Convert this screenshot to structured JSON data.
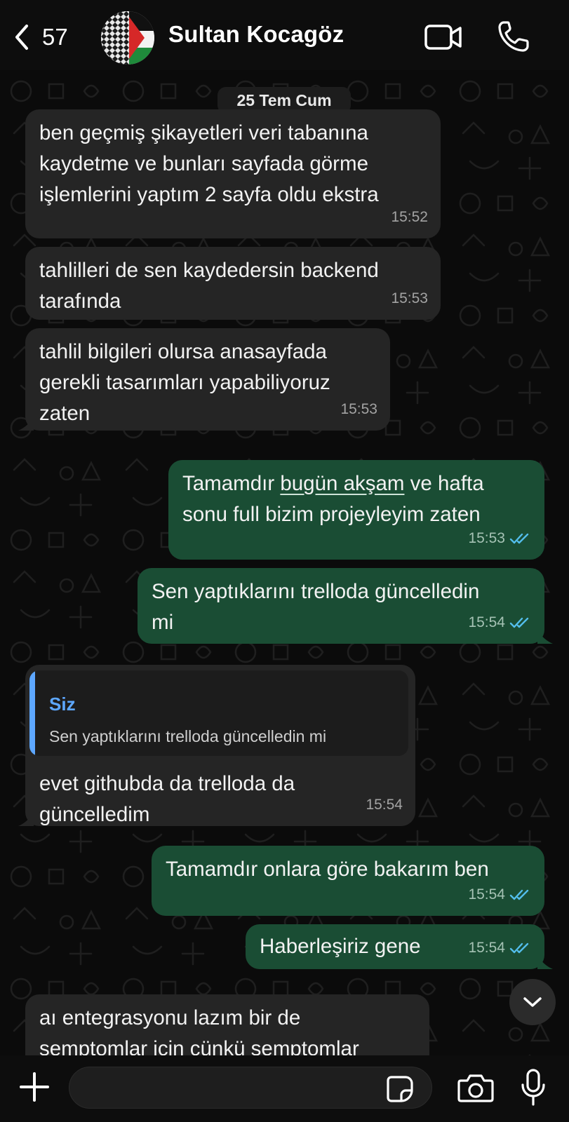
{
  "header": {
    "back_count": "57",
    "contact_name": "Sultan Kocagöz"
  },
  "date_chip": "25 Tem Cum",
  "messages": [
    {
      "direction": "in",
      "text": "ben geçmiş şikayetleri veri tabanına\nkaydetme ve bunları sayfada görme\nişlemlerini yaptım 2 sayfa oldu ekstra",
      "time": "15:52"
    },
    {
      "direction": "in",
      "text": "tahlilleri de sen kaydedersin backend\ntarafında",
      "time": "15:53"
    },
    {
      "direction": "in",
      "text": "tahlil bilgileri olursa anasayfada\ngerekli tasarımları yapabiliyoruz\nzaten",
      "time": "15:53"
    },
    {
      "direction": "out",
      "text_before": "Tamamdır ",
      "text_link": "bugün akşam",
      "text_after": " ve hafta\nsonu full bizim projeyleyim zaten",
      "time": "15:53",
      "status": "read"
    },
    {
      "direction": "out",
      "text": "Sen yaptıklarını trelloda güncelledin\nmi",
      "time": "15:54",
      "status": "read"
    },
    {
      "direction": "in",
      "quote_author": "Siz",
      "quote_text": "Sen yaptıklarını trelloda güncelledin mi",
      "text": "evet githubda da trelloda da\ngüncelledim",
      "time": "15:54"
    },
    {
      "direction": "out",
      "text": "Tamamdır onlara göre bakarım ben",
      "time": "15:54",
      "status": "read"
    },
    {
      "direction": "out",
      "text": "Haberleşiriz gene",
      "time": "15:54",
      "status": "read"
    },
    {
      "direction": "in",
      "text": "aı entegrasyonu lazım bir de\nsemptomlar için çünkü semptomlar",
      "time": ""
    }
  ],
  "composer": {
    "value": "",
    "placeholder": ""
  },
  "icons": [
    "back-chevron-icon",
    "video-call-icon",
    "phone-icon",
    "chevron-down-icon",
    "plus-icon",
    "sticker-icon",
    "camera-icon",
    "microphone-icon",
    "double-check-icon"
  ],
  "colors": {
    "incoming_bubble": "#252525",
    "outgoing_bubble": "#1a4d34",
    "read_ticks": "#53bdeb",
    "quote_accent": "#5da7ff"
  }
}
